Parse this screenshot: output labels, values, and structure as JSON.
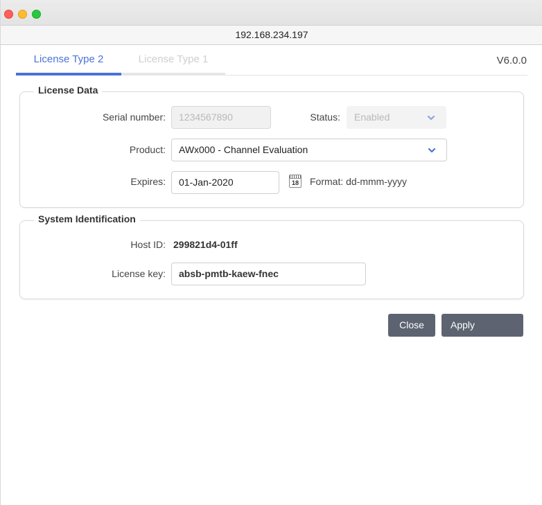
{
  "window": {
    "address": "192.168.234.197"
  },
  "tabs": [
    {
      "label": "License Type 2",
      "active": true
    },
    {
      "label": "License Type 1",
      "active": false
    }
  ],
  "version": "V6.0.0",
  "license_data": {
    "title": "License Data",
    "serial_label": "Serial number:",
    "serial_placeholder": "1234567890",
    "status_label": "Status:",
    "status_value": "Enabled",
    "product_label": "Product:",
    "product_value": "AWx000 - Channel Evaluation",
    "expires_label": "Expires:",
    "expires_value": "01-Jan-2020",
    "calendar_day": "18",
    "format_text": "Format: dd-mmm-yyyy"
  },
  "system_id": {
    "title": "System Identification",
    "host_label": "Host ID:",
    "host_value": "299821d4-01ff",
    "key_label": "License key:",
    "key_value": "absb-pmtb-kaew-fnec"
  },
  "buttons": {
    "close": "Close",
    "apply": "Apply"
  },
  "colors": {
    "accent": "#4a73d8",
    "button": "#5d6370"
  }
}
